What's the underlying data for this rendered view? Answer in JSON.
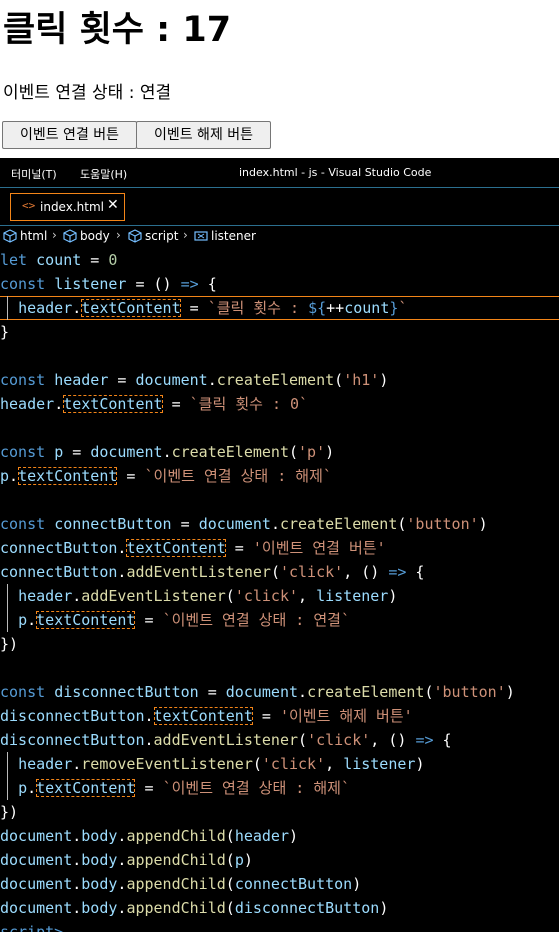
{
  "page": {
    "heading": "클릭 횟수 : 17",
    "status_text": "이벤트 연결 상태 : 연결",
    "buttons": {
      "connect": "이벤트 연결 버튼",
      "disconnect": "이벤트 해제 버튼"
    }
  },
  "vscode": {
    "menu": [
      "터미널(T)",
      "도움말(H)"
    ],
    "window_title": "index.html - js - Visual Studio Code",
    "tab": {
      "icon": "<>",
      "label": "index.html",
      "close": "✕"
    },
    "breadcrumb": [
      "html",
      "body",
      "script",
      "listener"
    ],
    "icons": {
      "html": "cube-icon",
      "body": "cube-icon",
      "script": "cube-icon",
      "listener": "variable-icon"
    }
  },
  "code": [
    "let count = 0",
    "const listener = () => {",
    "  header.textContent = `클릭 횟수 : ${++count}`",
    "}",
    "",
    "const header = document.createElement('h1')",
    "header.textContent = `클릭 횟수 : 0`",
    "",
    "const p = document.createElement('p')",
    "p.textContent = `이벤트 연결 상태 : 해제`",
    "",
    "const connectButton = document.createElement('button')",
    "connectButton.textContent = '이벤트 연결 버튼'",
    "connectButton.addEventListener('click', () => {",
    "  header.addEventListener('click', listener)",
    "  p.textContent = `이벤트 연결 상태 : 연결`",
    "})",
    "",
    "const disconnectButton = document.createElement('button')",
    "disconnectButton.textContent = '이벤트 해제 버튼'",
    "disconnectButton.addEventListener('click', () => {",
    "  header.removeEventListener('click', listener)",
    "  p.textContent = `이벤트 연결 상태 : 해제`",
    "})",
    "document.body.appendChild(header)",
    "document.body.appendChild(p)",
    "document.body.appendChild(connectButton)",
    "document.body.appendChild(disconnectButton)",
    "script>"
  ],
  "colors": {
    "keyword": "#569cd6",
    "variable": "#9cdcfe",
    "function": "#dcdcaa",
    "string": "#ce9178",
    "number": "#b5cea8",
    "highlight_border": "#f38518"
  }
}
